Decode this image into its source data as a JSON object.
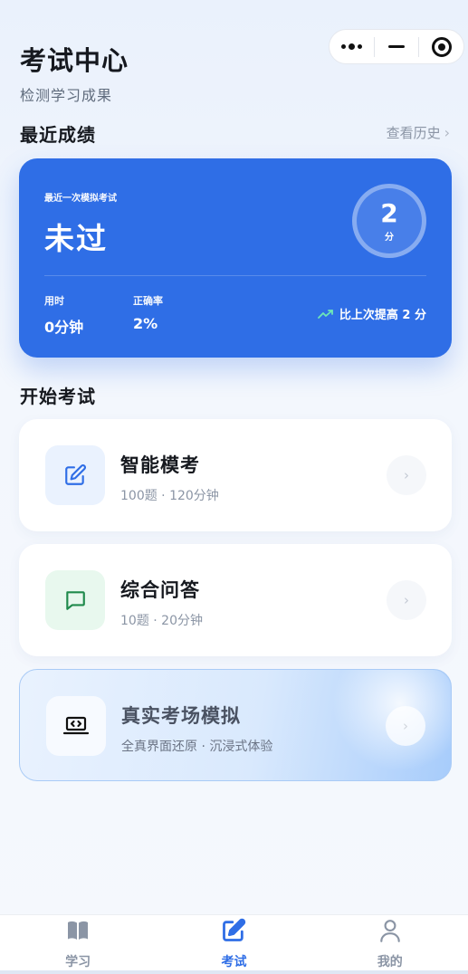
{
  "header": {
    "title": "考试中心",
    "subtitle": "检测学习成果"
  },
  "recent": {
    "section_title": "最近成绩",
    "history_label": "查看历史",
    "card": {
      "label": "最近一次模拟考试",
      "result": "未过",
      "score": "2",
      "score_unit": "分",
      "stats": [
        {
          "label": "用时",
          "value": "0分钟"
        },
        {
          "label": "正确率",
          "value": "2%"
        }
      ],
      "trend": "比上次提高 2 分"
    }
  },
  "start": {
    "section_title": "开始考试",
    "exams": [
      {
        "name": "智能模考",
        "meta": "100题 · 120分钟",
        "icon": "edit-icon"
      },
      {
        "name": "综合问答",
        "meta": "10题 · 20分钟",
        "icon": "chat-icon"
      },
      {
        "name": "真实考场模拟",
        "meta": "全真界面还原 · 沉浸式体验",
        "icon": "laptop-code-icon"
      }
    ]
  },
  "tabbar": {
    "items": [
      {
        "label": "学习",
        "icon": "book-icon"
      },
      {
        "label": "考试",
        "icon": "exam-edit-icon",
        "active": true
      },
      {
        "label": "我的",
        "icon": "user-icon"
      }
    ]
  },
  "colors": {
    "primary": "#2f6ee6",
    "trend_green": "#6ee7b7",
    "qa_green": "#1f8a4c"
  }
}
